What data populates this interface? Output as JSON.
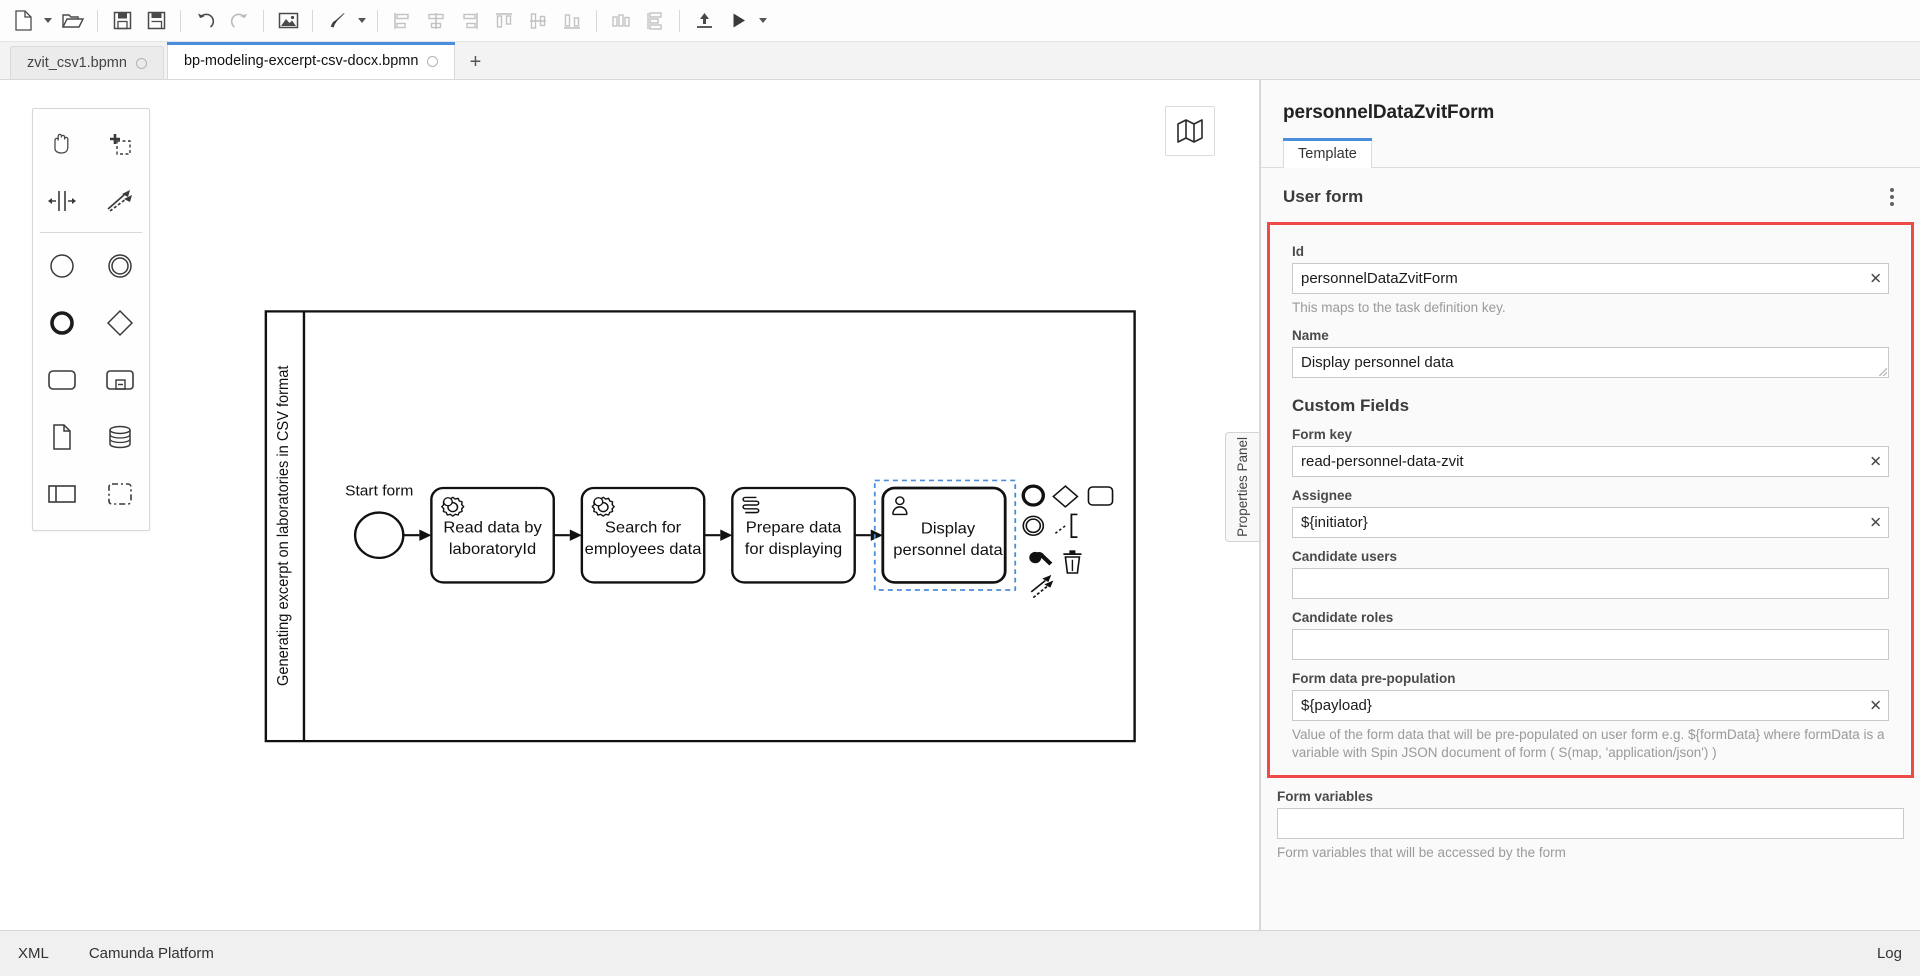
{
  "toolbar": {
    "buttons": [
      {
        "name": "new-file-button",
        "icon": "new-file-icon"
      },
      {
        "name": "new-file-dropdown",
        "icon": "chevron-down-icon"
      },
      {
        "name": "open-file-button",
        "icon": "open-folder-icon"
      },
      {
        "name": "save-button",
        "icon": "save-icon"
      },
      {
        "name": "save-as-button",
        "icon": "save-as-icon"
      },
      {
        "name": "undo-button",
        "icon": "undo-icon"
      },
      {
        "name": "redo-button",
        "icon": "redo-icon"
      },
      {
        "name": "export-image-button",
        "icon": "image-icon"
      },
      {
        "name": "format-paint-button",
        "icon": "paintbrush-icon"
      },
      {
        "name": "format-paint-dropdown",
        "icon": "chevron-down-icon"
      },
      {
        "name": "align-left-button",
        "icon": "align-left-icon"
      },
      {
        "name": "align-center-button",
        "icon": "align-center-icon"
      },
      {
        "name": "align-right-button",
        "icon": "align-right-icon"
      },
      {
        "name": "align-top-button",
        "icon": "align-top-icon"
      },
      {
        "name": "align-middle-button",
        "icon": "align-middle-icon"
      },
      {
        "name": "align-bottom-button",
        "icon": "align-bottom-icon"
      },
      {
        "name": "distribute-horizontal-button",
        "icon": "distribute-horizontal-icon"
      },
      {
        "name": "distribute-vertical-button",
        "icon": "distribute-vertical-icon"
      },
      {
        "name": "deploy-button",
        "icon": "deploy-upload-icon"
      },
      {
        "name": "start-instance-button",
        "icon": "play-icon"
      },
      {
        "name": "start-instance-dropdown",
        "icon": "chevron-down-icon"
      }
    ]
  },
  "tabs": {
    "items": [
      {
        "label": "zvit_csv1.bpmn",
        "active": false,
        "dirty": true
      },
      {
        "label": "bp-modeling-excerpt-csv-docx.bpmn",
        "active": true,
        "dirty": true
      }
    ],
    "add_label": "+"
  },
  "canvas": {
    "minimap_icon": "map-icon",
    "properties_panel_tab_label": "Properties Panel",
    "palette": [
      {
        "name": "hand-tool",
        "icon": "hand-icon"
      },
      {
        "name": "lasso-tool",
        "icon": "lasso-select-icon"
      },
      {
        "name": "space-tool",
        "icon": "space-tool-icon"
      },
      {
        "name": "global-connect-tool",
        "icon": "connect-arrow-icon"
      },
      {
        "name": "create-start-event",
        "icon": "circle-thin-icon"
      },
      {
        "name": "create-intermediate-event",
        "icon": "double-circle-icon"
      },
      {
        "name": "create-end-event",
        "icon": "circle-thick-icon"
      },
      {
        "name": "create-gateway",
        "icon": "diamond-icon"
      },
      {
        "name": "create-task",
        "icon": "rounded-rect-icon"
      },
      {
        "name": "create-subprocess-expanded",
        "icon": "subprocess-icon"
      },
      {
        "name": "create-data-object",
        "icon": "document-icon"
      },
      {
        "name": "create-data-store",
        "icon": "database-icon"
      },
      {
        "name": "create-participant",
        "icon": "pool-icon"
      },
      {
        "name": "create-group",
        "icon": "dashed-square-icon"
      }
    ]
  },
  "diagram": {
    "pool_label": "Generating excerpt on laboratories in CSV format",
    "start_event_label": "Start form",
    "tasks": [
      {
        "label": "Read data by laboratoryId",
        "type": "service"
      },
      {
        "label": "Search for employees data",
        "type": "service"
      },
      {
        "label": "Prepare data for displaying",
        "type": "script"
      },
      {
        "label": "Display personnel data",
        "type": "user",
        "selected": true
      }
    ],
    "context_pad": [
      {
        "name": "append-end-event",
        "icon": "circle-thick-icon"
      },
      {
        "name": "append-gateway",
        "icon": "diamond-icon"
      },
      {
        "name": "append-task",
        "icon": "rounded-rect-icon"
      },
      {
        "name": "append-intermediate-event",
        "icon": "double-circle-icon"
      },
      {
        "name": "append-text-annotation",
        "icon": "text-annotation-icon"
      },
      {
        "name": "change-element-type",
        "icon": "wrench-icon"
      },
      {
        "name": "delete-element",
        "icon": "trash-icon"
      },
      {
        "name": "connect-element",
        "icon": "connect-arrow-icon"
      }
    ]
  },
  "panel": {
    "title": "personnelDataZvitForm",
    "tabs": [
      {
        "label": "Template"
      }
    ],
    "group_title": "User form",
    "kebab_icon": "more-vertical-icon",
    "fields": [
      {
        "label": "Id",
        "value": "personnelDataZvitForm",
        "placeholder": "",
        "clearable": true,
        "hint": "This maps to the task definition key."
      },
      {
        "label": "Name",
        "value": "Display personnel data",
        "placeholder": "",
        "clearable": false,
        "hint": ""
      }
    ],
    "custom_fields_title": "Custom Fields",
    "custom_fields": [
      {
        "label": "Form key",
        "value": "read-personnel-data-zvit",
        "placeholder": "",
        "clearable": true,
        "hint": ""
      },
      {
        "label": "Assignee",
        "value": "${initiator}",
        "placeholder": "",
        "clearable": true,
        "hint": ""
      },
      {
        "label": "Candidate users",
        "value": "",
        "placeholder": "",
        "clearable": false,
        "hint": ""
      },
      {
        "label": "Candidate roles",
        "value": "",
        "placeholder": "",
        "clearable": false,
        "hint": ""
      },
      {
        "label": "Form data pre-population",
        "value": "${payload}",
        "placeholder": "",
        "clearable": true,
        "hint": "Value of the form data that will be pre-populated on user form\ne.g. ${formData} where formData is a variable with Spin JSON document of form ( S(map, 'application/json') )"
      }
    ],
    "trailing_fields": [
      {
        "label": "Form variables",
        "value": "",
        "placeholder": "",
        "clearable": false,
        "hint": "Form variables that will be accessed by the form"
      }
    ],
    "highlight_color": "#f04a48"
  },
  "statusbar": {
    "left_items": [
      {
        "label": "XML",
        "name": "statusbar-xml"
      },
      {
        "label": "Camunda Platform",
        "name": "statusbar-engine"
      }
    ],
    "right_items": [
      {
        "label": "Log",
        "name": "statusbar-log"
      }
    ]
  }
}
